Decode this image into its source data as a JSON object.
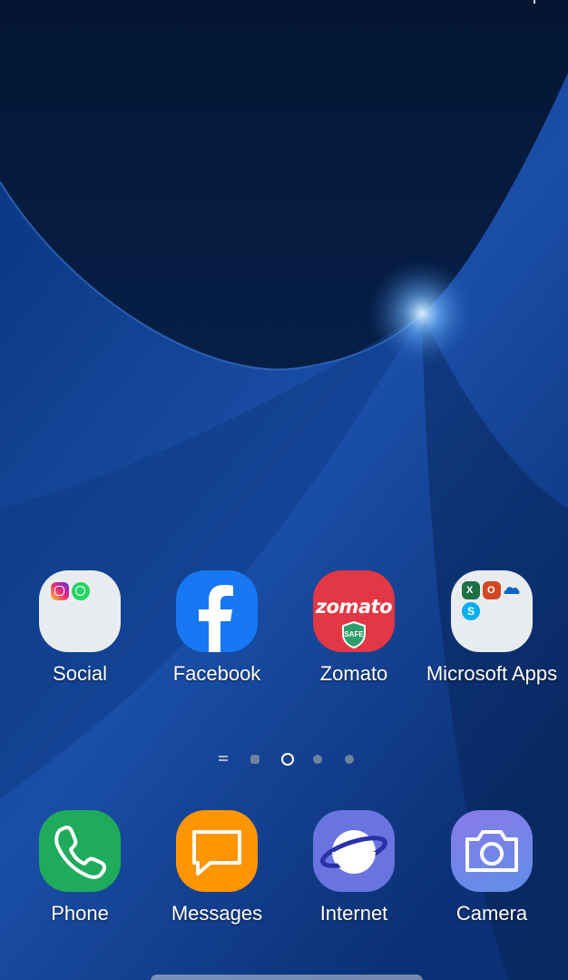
{
  "home": {
    "apps": [
      {
        "label": "Social",
        "icon": "social-folder-icon"
      },
      {
        "label": "Facebook",
        "icon": "facebook-icon"
      },
      {
        "label": "Zomato",
        "icon": "zomato-icon"
      },
      {
        "label": "Microsoft Apps",
        "icon": "microsoft-apps-folder-icon"
      }
    ],
    "zomato": {
      "wordmark": "zomato",
      "badge": "SAFE"
    },
    "page_indicator": {
      "pages": 4,
      "current": 2
    }
  },
  "dock": {
    "apps": [
      {
        "label": "Phone",
        "icon": "phone-icon"
      },
      {
        "label": "Messages",
        "icon": "messages-icon"
      },
      {
        "label": "Internet",
        "icon": "internet-icon"
      },
      {
        "label": "Camera",
        "icon": "camera-icon"
      }
    ]
  },
  "colors": {
    "facebook": "#1877f2",
    "zomato": "#e23744",
    "phone": "#1faa5c",
    "messages": "#ff9500",
    "internet": "#6a74e0",
    "camera": "#7a86e6",
    "folder": "#e9ecef"
  }
}
